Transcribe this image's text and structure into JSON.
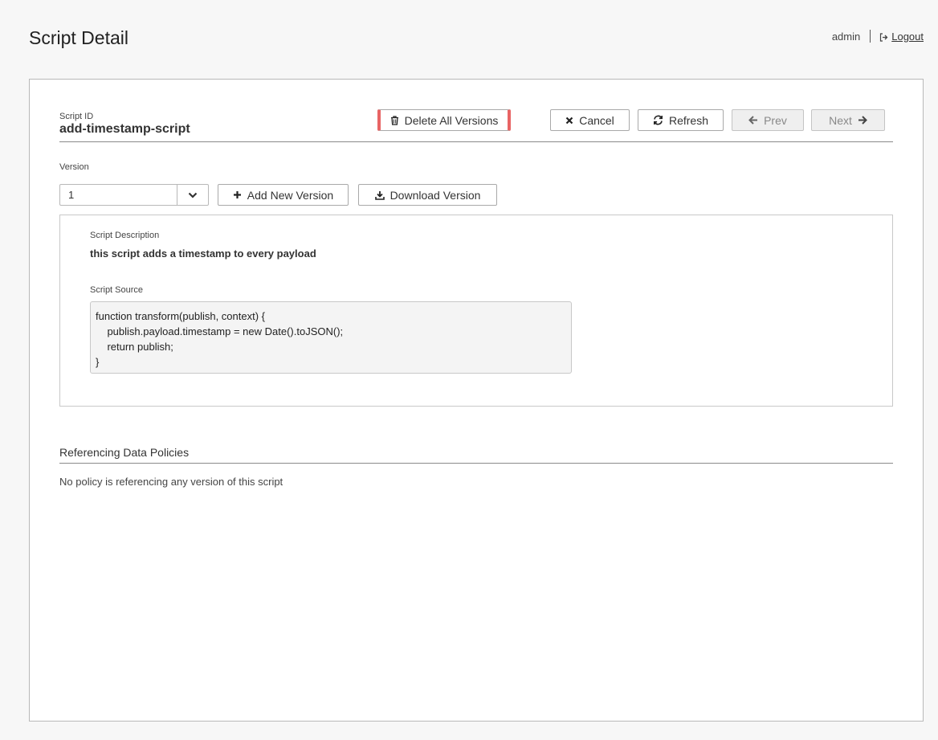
{
  "header": {
    "title": "Script Detail",
    "user": "admin",
    "logout_label": "Logout"
  },
  "script": {
    "id_label": "Script ID",
    "id_value": "add-timestamp-script"
  },
  "toolbar": {
    "delete_all_label": "Delete All Versions",
    "cancel_label": "Cancel",
    "refresh_label": "Refresh",
    "prev_label": "Prev",
    "next_label": "Next"
  },
  "version": {
    "label": "Version",
    "selected": "1",
    "add_label": "Add New Version",
    "download_label": "Download Version"
  },
  "details": {
    "description_label": "Script Description",
    "description_value": "this script adds a timestamp to every payload",
    "source_label": "Script Source",
    "source_code": "function transform(publish, context) {\n    publish.payload.timestamp = new Date().toJSON();\n    return publish;\n}"
  },
  "references": {
    "title": "Referencing Data Policies",
    "empty_text": "No policy is referencing any version of this script"
  },
  "colors": {
    "danger_accent": "#e86464",
    "panel_border": "#b8b8b8",
    "code_background": "#f4f4f4"
  }
}
